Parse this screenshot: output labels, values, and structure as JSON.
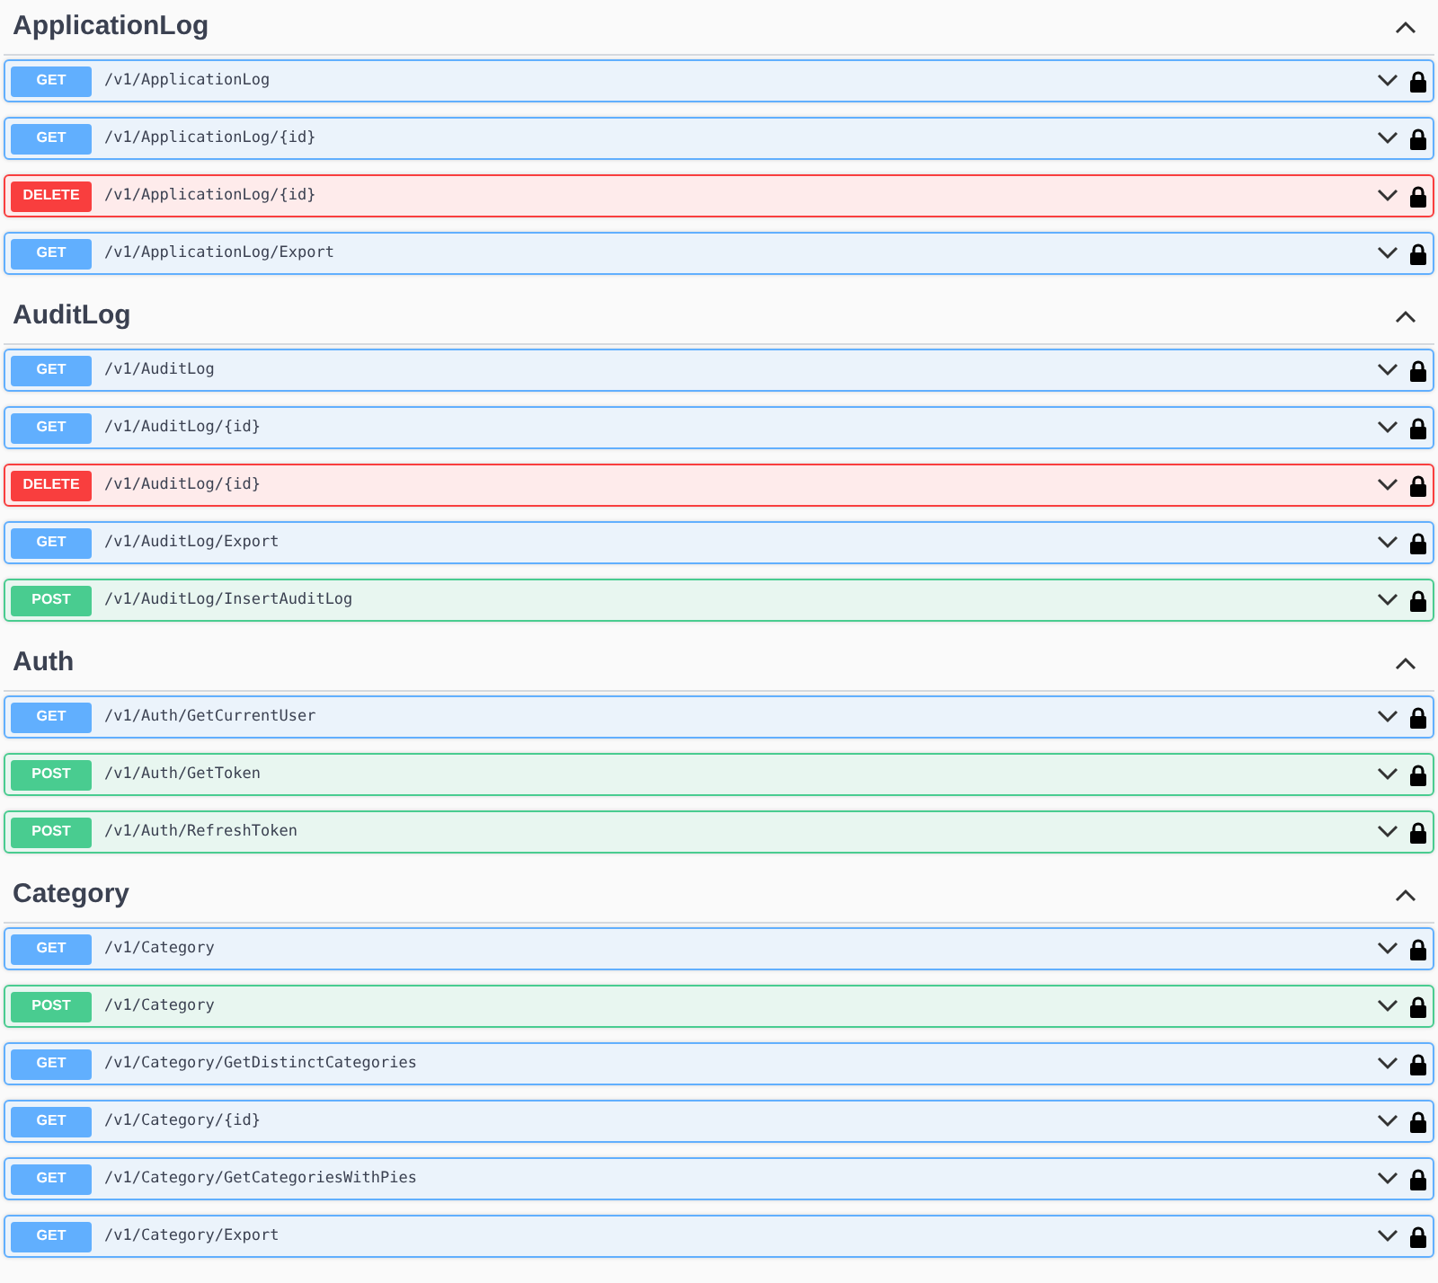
{
  "sections": [
    {
      "title": "ApplicationLog",
      "expanded": true,
      "operations": [
        {
          "method": "GET",
          "path": "/v1/ApplicationLog"
        },
        {
          "method": "GET",
          "path": "/v1/ApplicationLog/{id}"
        },
        {
          "method": "DELETE",
          "path": "/v1/ApplicationLog/{id}"
        },
        {
          "method": "GET",
          "path": "/v1/ApplicationLog/Export"
        }
      ]
    },
    {
      "title": "AuditLog",
      "expanded": true,
      "operations": [
        {
          "method": "GET",
          "path": "/v1/AuditLog"
        },
        {
          "method": "GET",
          "path": "/v1/AuditLog/{id}"
        },
        {
          "method": "DELETE",
          "path": "/v1/AuditLog/{id}"
        },
        {
          "method": "GET",
          "path": "/v1/AuditLog/Export"
        },
        {
          "method": "POST",
          "path": "/v1/AuditLog/InsertAuditLog"
        }
      ]
    },
    {
      "title": "Auth",
      "expanded": true,
      "operations": [
        {
          "method": "GET",
          "path": "/v1/Auth/GetCurrentUser"
        },
        {
          "method": "POST",
          "path": "/v1/Auth/GetToken"
        },
        {
          "method": "POST",
          "path": "/v1/Auth/RefreshToken"
        }
      ]
    },
    {
      "title": "Category",
      "expanded": true,
      "operations": [
        {
          "method": "GET",
          "path": "/v1/Category"
        },
        {
          "method": "POST",
          "path": "/v1/Category"
        },
        {
          "method": "GET",
          "path": "/v1/Category/GetDistinctCategories"
        },
        {
          "method": "GET",
          "path": "/v1/Category/{id}"
        },
        {
          "method": "GET",
          "path": "/v1/Category/GetCategoriesWithPies"
        },
        {
          "method": "GET",
          "path": "/v1/Category/Export"
        }
      ]
    }
  ]
}
